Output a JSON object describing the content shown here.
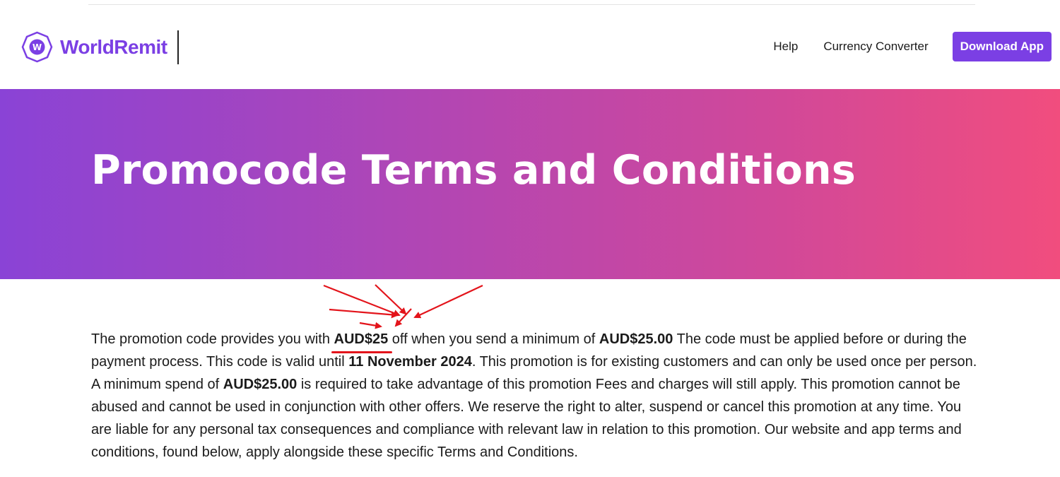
{
  "brand": {
    "name": "WorldRemit",
    "logo_letter": "W",
    "color": "#7b3fe4"
  },
  "nav": {
    "help": "Help",
    "currency_converter": "Currency Converter",
    "download_app": "Download App"
  },
  "hero": {
    "title": "Promocode Terms and Conditions",
    "gradient": [
      "#8a43d6",
      "#b146b4",
      "#d0489a",
      "#f14d7e"
    ]
  },
  "terms": {
    "t1": "The promotion code provides you with ",
    "discount": "AUD$25",
    "t2": " off when you send a minimum of ",
    "minimum": "AUD$25.00",
    "t3": " The code must be applied before or during the payment process. This code is valid until ",
    "valid_until": "11 November 2024",
    "t4": ". This promotion is for existing customers and can only be used once per person. A minimum spend of ",
    "minimum_spend": "AUD$25.00",
    "t5": " is required to take advantage of this promotion Fees and charges will still apply. This promotion cannot be abused and cannot be used in conjunction with other offers. We reserve the right to alter, suspend or cancel this promotion at any time. You are liable for any personal tax consequences and compliance with relevant law in relation to this promotion. Our website and app terms and conditions, found below, apply alongside these specific Terms and Conditions."
  },
  "annotation": {
    "color": "#e3141b"
  }
}
